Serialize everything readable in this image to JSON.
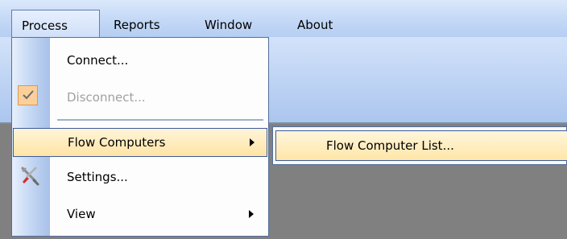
{
  "menubar": {
    "items": [
      {
        "label": "Process"
      },
      {
        "label": "Reports"
      },
      {
        "label": "Window"
      },
      {
        "label": "About"
      }
    ]
  },
  "process_menu": {
    "items": [
      {
        "label": "Connect...",
        "enabled": true
      },
      {
        "label": "Disconnect...",
        "enabled": false,
        "checked": true
      },
      {
        "label": "Flow Computers",
        "has_submenu": true,
        "highlighted": true
      },
      {
        "label": "Settings...",
        "icon": "settings-tools-icon"
      },
      {
        "label": "View",
        "has_submenu": true
      }
    ]
  },
  "flow_submenu": {
    "items": [
      {
        "label": "Flow Computer List...",
        "highlighted": true
      }
    ]
  },
  "colors": {
    "menubar_bg": "#c3d8f6",
    "highlight": "#ffe4a4",
    "highlight_border": "#3d5a9a",
    "workspace": "#808080"
  }
}
